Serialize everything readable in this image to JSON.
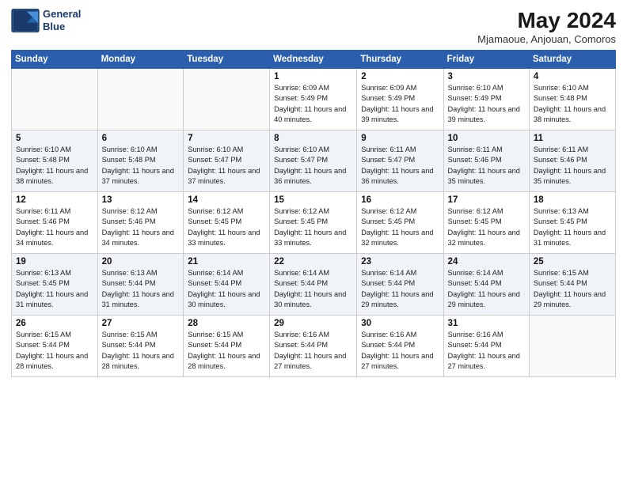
{
  "header": {
    "logo_line1": "General",
    "logo_line2": "Blue",
    "month": "May 2024",
    "location": "Mjamaoue, Anjouan, Comoros"
  },
  "weekdays": [
    "Sunday",
    "Monday",
    "Tuesday",
    "Wednesday",
    "Thursday",
    "Friday",
    "Saturday"
  ],
  "weeks": [
    [
      {
        "day": "",
        "sunrise": "",
        "sunset": "",
        "daylight": ""
      },
      {
        "day": "",
        "sunrise": "",
        "sunset": "",
        "daylight": ""
      },
      {
        "day": "",
        "sunrise": "",
        "sunset": "",
        "daylight": ""
      },
      {
        "day": "1",
        "sunrise": "6:09 AM",
        "sunset": "5:49 PM",
        "daylight": "11 hours and 40 minutes."
      },
      {
        "day": "2",
        "sunrise": "6:09 AM",
        "sunset": "5:49 PM",
        "daylight": "11 hours and 39 minutes."
      },
      {
        "day": "3",
        "sunrise": "6:10 AM",
        "sunset": "5:49 PM",
        "daylight": "11 hours and 39 minutes."
      },
      {
        "day": "4",
        "sunrise": "6:10 AM",
        "sunset": "5:48 PM",
        "daylight": "11 hours and 38 minutes."
      }
    ],
    [
      {
        "day": "5",
        "sunrise": "6:10 AM",
        "sunset": "5:48 PM",
        "daylight": "11 hours and 38 minutes."
      },
      {
        "day": "6",
        "sunrise": "6:10 AM",
        "sunset": "5:48 PM",
        "daylight": "11 hours and 37 minutes."
      },
      {
        "day": "7",
        "sunrise": "6:10 AM",
        "sunset": "5:47 PM",
        "daylight": "11 hours and 37 minutes."
      },
      {
        "day": "8",
        "sunrise": "6:10 AM",
        "sunset": "5:47 PM",
        "daylight": "11 hours and 36 minutes."
      },
      {
        "day": "9",
        "sunrise": "6:11 AM",
        "sunset": "5:47 PM",
        "daylight": "11 hours and 36 minutes."
      },
      {
        "day": "10",
        "sunrise": "6:11 AM",
        "sunset": "5:46 PM",
        "daylight": "11 hours and 35 minutes."
      },
      {
        "day": "11",
        "sunrise": "6:11 AM",
        "sunset": "5:46 PM",
        "daylight": "11 hours and 35 minutes."
      }
    ],
    [
      {
        "day": "12",
        "sunrise": "6:11 AM",
        "sunset": "5:46 PM",
        "daylight": "11 hours and 34 minutes."
      },
      {
        "day": "13",
        "sunrise": "6:12 AM",
        "sunset": "5:46 PM",
        "daylight": "11 hours and 34 minutes."
      },
      {
        "day": "14",
        "sunrise": "6:12 AM",
        "sunset": "5:45 PM",
        "daylight": "11 hours and 33 minutes."
      },
      {
        "day": "15",
        "sunrise": "6:12 AM",
        "sunset": "5:45 PM",
        "daylight": "11 hours and 33 minutes."
      },
      {
        "day": "16",
        "sunrise": "6:12 AM",
        "sunset": "5:45 PM",
        "daylight": "11 hours and 32 minutes."
      },
      {
        "day": "17",
        "sunrise": "6:12 AM",
        "sunset": "5:45 PM",
        "daylight": "11 hours and 32 minutes."
      },
      {
        "day": "18",
        "sunrise": "6:13 AM",
        "sunset": "5:45 PM",
        "daylight": "11 hours and 31 minutes."
      }
    ],
    [
      {
        "day": "19",
        "sunrise": "6:13 AM",
        "sunset": "5:45 PM",
        "daylight": "11 hours and 31 minutes."
      },
      {
        "day": "20",
        "sunrise": "6:13 AM",
        "sunset": "5:44 PM",
        "daylight": "11 hours and 31 minutes."
      },
      {
        "day": "21",
        "sunrise": "6:14 AM",
        "sunset": "5:44 PM",
        "daylight": "11 hours and 30 minutes."
      },
      {
        "day": "22",
        "sunrise": "6:14 AM",
        "sunset": "5:44 PM",
        "daylight": "11 hours and 30 minutes."
      },
      {
        "day": "23",
        "sunrise": "6:14 AM",
        "sunset": "5:44 PM",
        "daylight": "11 hours and 29 minutes."
      },
      {
        "day": "24",
        "sunrise": "6:14 AM",
        "sunset": "5:44 PM",
        "daylight": "11 hours and 29 minutes."
      },
      {
        "day": "25",
        "sunrise": "6:15 AM",
        "sunset": "5:44 PM",
        "daylight": "11 hours and 29 minutes."
      }
    ],
    [
      {
        "day": "26",
        "sunrise": "6:15 AM",
        "sunset": "5:44 PM",
        "daylight": "11 hours and 28 minutes."
      },
      {
        "day": "27",
        "sunrise": "6:15 AM",
        "sunset": "5:44 PM",
        "daylight": "11 hours and 28 minutes."
      },
      {
        "day": "28",
        "sunrise": "6:15 AM",
        "sunset": "5:44 PM",
        "daylight": "11 hours and 28 minutes."
      },
      {
        "day": "29",
        "sunrise": "6:16 AM",
        "sunset": "5:44 PM",
        "daylight": "11 hours and 27 minutes."
      },
      {
        "day": "30",
        "sunrise": "6:16 AM",
        "sunset": "5:44 PM",
        "daylight": "11 hours and 27 minutes."
      },
      {
        "day": "31",
        "sunrise": "6:16 AM",
        "sunset": "5:44 PM",
        "daylight": "11 hours and 27 minutes."
      },
      {
        "day": "",
        "sunrise": "",
        "sunset": "",
        "daylight": ""
      }
    ]
  ],
  "labels": {
    "sunrise": "Sunrise:",
    "sunset": "Sunset:",
    "daylight": "Daylight:"
  }
}
